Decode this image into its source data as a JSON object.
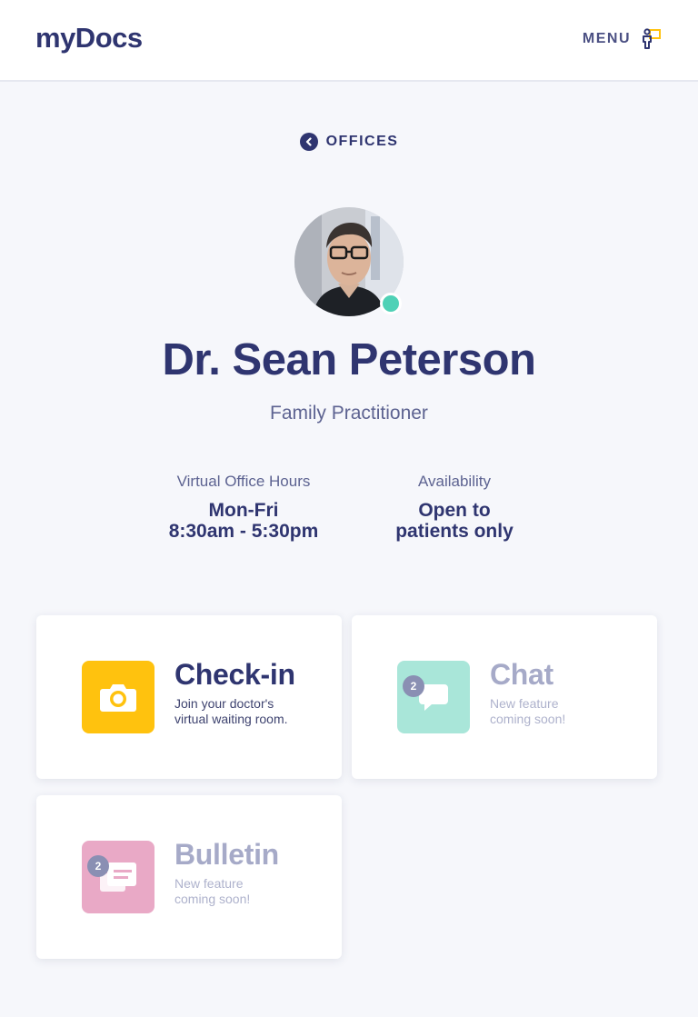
{
  "header": {
    "logo": "myDocs",
    "menu_label": "MENU",
    "menu_icon": "person-menu-icon"
  },
  "nav": {
    "back_label": "OFFICES",
    "back_icon": "chevron-left-circle-icon"
  },
  "doctor": {
    "name": "Dr. Sean Peterson",
    "role": "Family Practitioner",
    "status": "online",
    "status_color": "#4fd1b6"
  },
  "info": {
    "hours_label": "Virtual Office Hours",
    "hours_line1": "Mon-Fri",
    "hours_line2": "8:30am - 5:30pm",
    "availability_label": "Availability",
    "availability_line1": "Open to",
    "availability_line2": "patients only"
  },
  "cards": [
    {
      "title": "Check-in",
      "desc_line1": "Join your doctor's",
      "desc_line2": "virtual waiting room.",
      "icon": "camera-icon",
      "icon_color": "#ffc20e",
      "badge": ""
    },
    {
      "title": "Chat",
      "desc_line1": "New feature",
      "desc_line2": "coming soon!",
      "icon": "chat-bubble-icon",
      "icon_color": "#a9e6d9",
      "badge": "2"
    },
    {
      "title": "Bulletin",
      "desc_line1": "New feature",
      "desc_line2": "coming soon!",
      "icon": "bulletin-icon",
      "icon_color": "#e9a9c6",
      "badge": "2"
    }
  ]
}
